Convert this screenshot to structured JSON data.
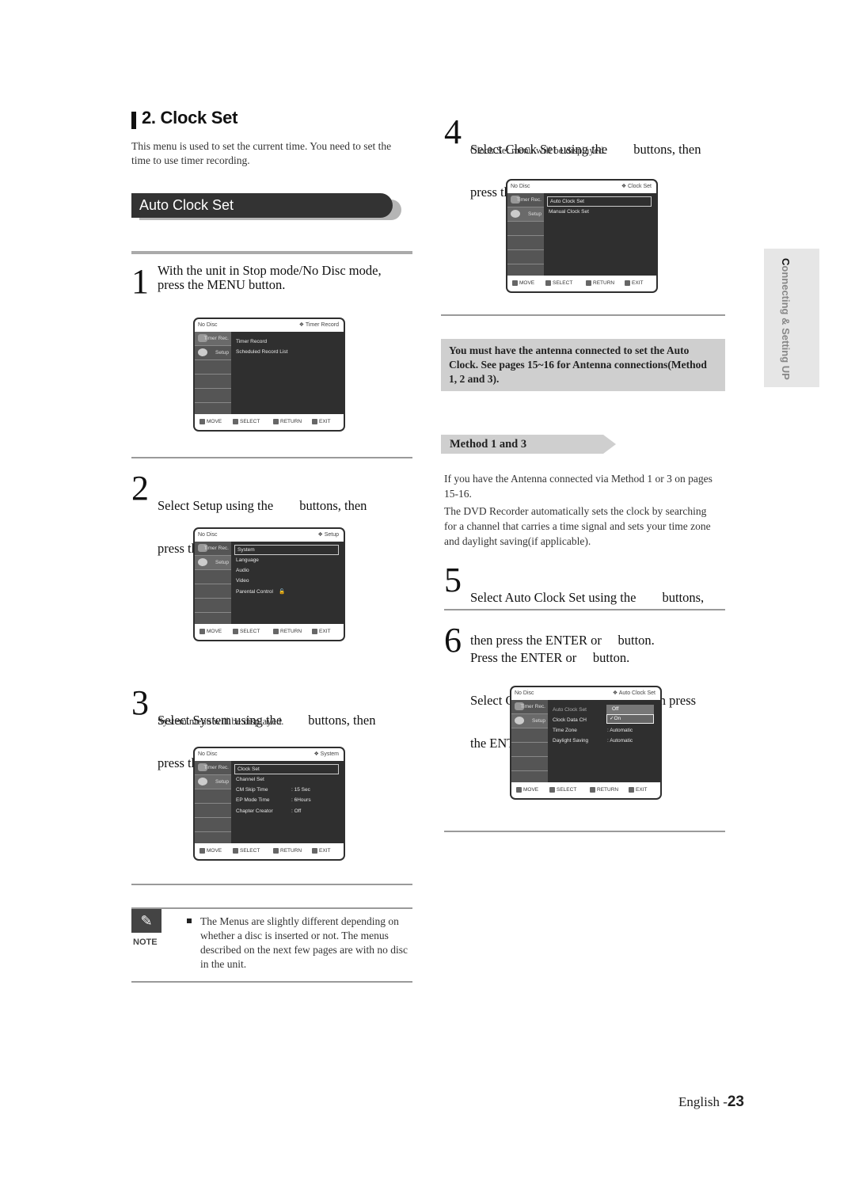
{
  "section": {
    "number_title": "2.  Clock Set",
    "intro": "This menu is used to set the current time. You need to set the time to use timer recording."
  },
  "banner": {
    "label": "Auto Clock Set"
  },
  "steps": [
    {
      "num": "1",
      "line1": "With the unit in Stop mode/No Disc mode,",
      "line2": "press the MENU button.",
      "sub": ""
    },
    {
      "num": "2",
      "line1": "Select Setup using the        buttons, then",
      "line2": "press the ENTER or     button.",
      "sub": ""
    },
    {
      "num": "3",
      "line1": "Select System using the        buttons, then",
      "line2": "press the ENTER or     button.",
      "sub": "System menu will be displayed."
    },
    {
      "num": "4",
      "line1": "Select Clock Set using the        buttons, then",
      "line2": "press the ENTER or     button.",
      "sub": "Clock Set menu will be displayed."
    },
    {
      "num": "5",
      "line1": "Select Auto Clock Set using the        buttons,",
      "line2": "then press the ENTER or     button.",
      "sub": ""
    },
    {
      "num": "6",
      "line1": "Press the ENTER or     button.",
      "line2": "Select On using the        buttons, then press",
      "line3": "the ENTER or     button."
    }
  ],
  "osd_common": {
    "disc_status": "No Disc",
    "side_items": [
      "Timer Rec.",
      "Setup"
    ],
    "footer": {
      "move": "MOVE",
      "select": "SELECT",
      "return": "RETURN",
      "exit": "EXIT"
    }
  },
  "screens": {
    "timer_record": {
      "title": "❖ Timer Record",
      "items": [
        "Timer Record",
        "Scheduled Record List"
      ]
    },
    "setup": {
      "title": "❖ Setup",
      "items": [
        "System",
        "Language",
        "Audio",
        "Video",
        "Parental Control"
      ],
      "lock_icon": "🔓"
    },
    "system": {
      "title": "❖ System",
      "items": [
        {
          "label": "Clock Set",
          "value": ""
        },
        {
          "label": "Channel Set",
          "value": ""
        },
        {
          "label": "CM Skip Time",
          "value": ": 15 Sec"
        },
        {
          "label": "EP Mode Time",
          "value": ": 6Hours"
        },
        {
          "label": "Chapter Creator",
          "value": ": Off"
        }
      ]
    },
    "clock_set": {
      "title": "❖ Clock Set",
      "items": [
        "Auto Clock Set",
        "Manual Clock Set"
      ]
    },
    "auto_clock_set": {
      "title": "❖ Auto Clock Set",
      "items": [
        {
          "label": "Auto Clock Set",
          "value": ""
        },
        {
          "label": "Clock Data CH",
          "value": ""
        },
        {
          "label": "Time Zone",
          "value": ": Automatic"
        },
        {
          "label": "Daylight Saving",
          "value": ": Automatic"
        }
      ],
      "options": [
        "Off",
        "✓On"
      ],
      "selected_option": "On"
    }
  },
  "warning": "You must have the antenna connected to set the Auto Clock. See pages 15~16 for Antenna connections(Method 1, 2 and 3).",
  "method": {
    "label": "Method 1 and 3",
    "para1": "If you have the Antenna connected via Method 1 or 3 on pages 15-16.",
    "para2": "The DVD Recorder automatically sets the clock by searching for a channel that carries a time signal and sets your time zone and daylight saving(if applicable)."
  },
  "side_tab": {
    "first": "C",
    "rest": "onnecting & Setting UP"
  },
  "note": {
    "label": "NOTE",
    "text": "The Menus are slightly different depending on whether a disc is inserted or not. The menus described on the next few pages are with no disc in the unit."
  },
  "footer": {
    "lang": "English -",
    "page": "23"
  }
}
